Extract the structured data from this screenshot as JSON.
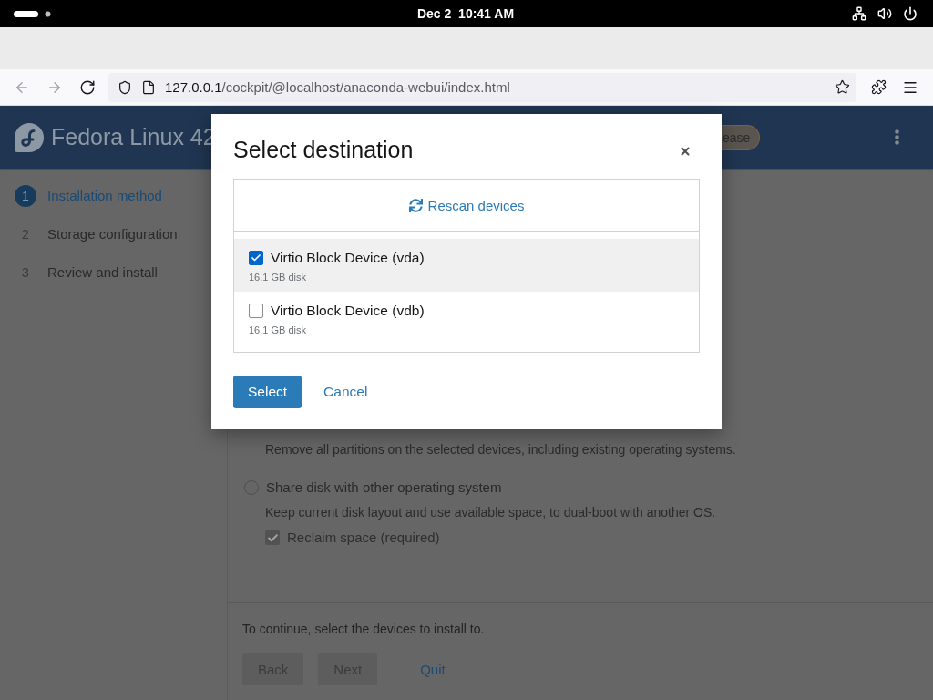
{
  "top_bar": {
    "clock": "Dec 2  10:41 AM"
  },
  "browser": {
    "nav_buttons": [
      {
        "kind": "back",
        "disabled": true
      },
      {
        "kind": "forward",
        "disabled": true
      },
      {
        "kind": "reload",
        "disabled": false
      }
    ],
    "url": {
      "host": "127.0.0.1",
      "path": "/cockpit/@localhost/anaconda-webui/index.html"
    }
  },
  "header": {
    "title": "Fedora Linux 42",
    "badge": "ease"
  },
  "steps": [
    {
      "number": "1",
      "label": "Installation method",
      "selected": true
    },
    {
      "number": "2",
      "label": "Storage configuration",
      "selected": false
    },
    {
      "number": "3",
      "label": "Review and install",
      "selected": false
    }
  ],
  "content": {
    "options": [
      {
        "description": "Remove all partitions on the selected devices, including existing operating systems."
      },
      {
        "label": "Share disk with other operating system",
        "selected": false,
        "description": "Keep current disk layout and use available space, to dual-boot with another OS.",
        "checkbox": {
          "label": "Reclaim space (required)",
          "checked": true,
          "disabled": true
        }
      }
    ]
  },
  "footer": {
    "hint": "To continue, select the devices to install to.",
    "buttons": [
      {
        "label": "Back",
        "kind": "secondary",
        "disabled": true
      },
      {
        "label": "Next",
        "kind": "secondary",
        "disabled": true
      },
      {
        "label": "Quit",
        "kind": "link",
        "disabled": false
      }
    ]
  },
  "dialog": {
    "title": "Select destination",
    "rescan": "Rescan devices",
    "devices": [
      {
        "name": "Virtio Block Device (vda)",
        "size": "16.1 GB disk",
        "checked": true,
        "highlighted": true
      },
      {
        "name": "Virtio Block Device (vdb)",
        "size": "16.1 GB disk",
        "checked": false,
        "highlighted": false
      }
    ],
    "buttons": [
      {
        "label": "Select",
        "kind": "primary"
      },
      {
        "label": "Cancel",
        "kind": "link"
      }
    ]
  }
}
